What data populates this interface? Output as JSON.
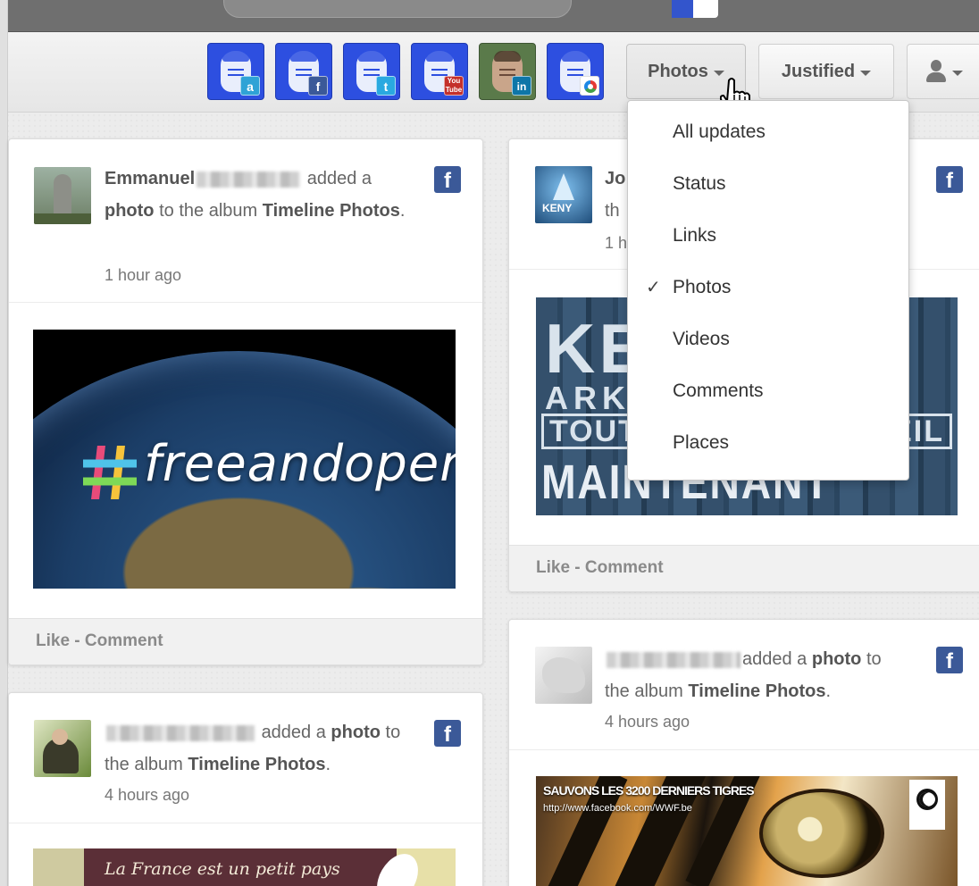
{
  "toolbar": {
    "networks": [
      {
        "name": "amazon",
        "badge": "a"
      },
      {
        "name": "facebook",
        "badge": "f"
      },
      {
        "name": "twitter",
        "badge": "t"
      },
      {
        "name": "youtube",
        "badge": "You Tube"
      },
      {
        "name": "linkedin",
        "badge": "in"
      },
      {
        "name": "picasa",
        "badge": ""
      }
    ],
    "filter_label": "Photos",
    "layout_label": "Justified"
  },
  "filter_menu": {
    "items": [
      {
        "label": "All updates",
        "checked": false
      },
      {
        "label": "Status",
        "checked": false
      },
      {
        "label": "Links",
        "checked": false
      },
      {
        "label": "Photos",
        "checked": true
      },
      {
        "label": "Videos",
        "checked": false
      },
      {
        "label": "Comments",
        "checked": false
      },
      {
        "label": "Places",
        "checked": false
      }
    ],
    "check_glyph": "✓"
  },
  "posts": [
    {
      "author": "Emmanuel",
      "action": "added a",
      "object": "photo",
      "connector": "to the album",
      "album": "Timeline Photos",
      "time": "1 hour ago",
      "image_text": "freeandopen",
      "footer": {
        "like": "Like",
        "sep": " - ",
        "comment": "Comment"
      }
    },
    {
      "author": "Jo",
      "line2": "th",
      "time": "1 h",
      "image_text": {
        "big": "KE",
        "mid": "ARK",
        "band1": "TOUT",
        "band1_right": "EIL",
        "band2": "MAINTENANT DISPONIBLE"
      },
      "avatar_text": "KENY",
      "footer": {
        "like": "Like",
        "sep": " - ",
        "comment": "Comment"
      }
    },
    {
      "action": "added a",
      "object": "photo",
      "connector": "to",
      "connector2": "the album",
      "album": "Timeline Photos",
      "time": "4 hours ago",
      "image_text": "La France est un petit pays"
    },
    {
      "action": "added a",
      "object": "photo",
      "connector": "to",
      "connector2": "the album",
      "album": "Timeline Photos",
      "time": "4 hours ago",
      "image_text": {
        "headline": "SAUVONS LES 3200 DERNIERS TIGRES",
        "url": "http://www.facebook.com/WWF.be",
        "logo": "WWF"
      }
    }
  ],
  "colors": {
    "facebook": "#3b5998",
    "network_blue": "#2d4fe0"
  }
}
